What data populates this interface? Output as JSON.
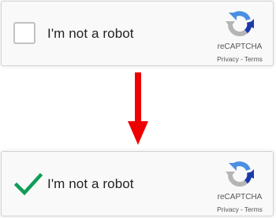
{
  "before": {
    "checked": false,
    "label": "I'm not a robot",
    "brand": "reCAPTCHA",
    "privacy_link": "Privacy",
    "separator": "-",
    "terms_link": "Terms"
  },
  "after": {
    "checked": true,
    "label": "I'm not a robot",
    "brand": "reCAPTCHA",
    "privacy_link": "Privacy",
    "separator": "-",
    "terms_link": "Terms"
  },
  "icons": {
    "logo": "recaptcha-logo-icon",
    "checkmark": "checkmark-icon",
    "arrow": "arrow-down-icon"
  },
  "colors": {
    "arrow": "#ee0000",
    "checkmark": "#0f9d58",
    "logo_blue": "#4a90e2",
    "logo_dark_blue": "#1c3aa9",
    "logo_gray": "#b5b5b5",
    "panel_bg": "#f9f9f9",
    "panel_border": "#d3d3d3"
  }
}
